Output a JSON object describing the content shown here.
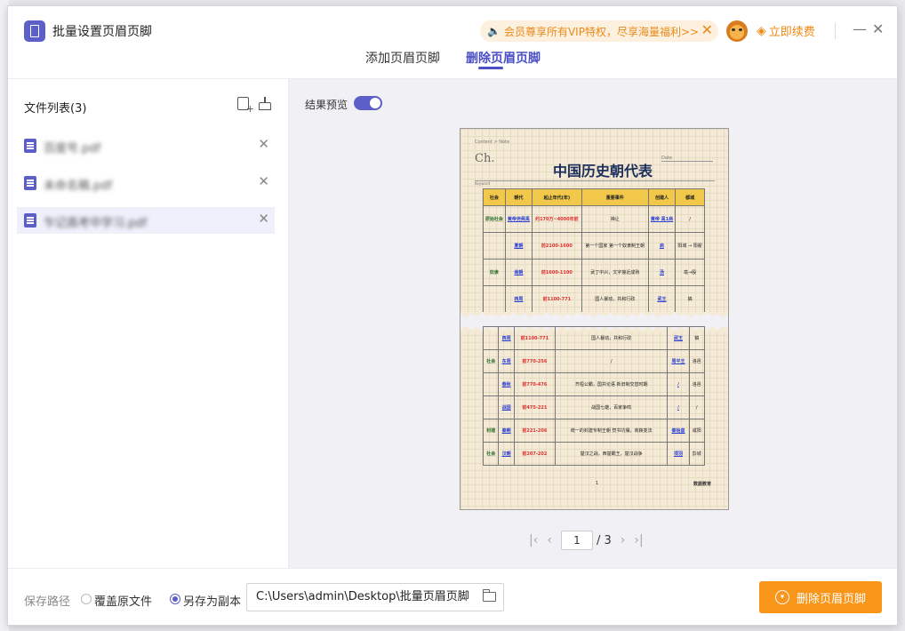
{
  "app": {
    "title": "批量设置页眉页脚"
  },
  "vip_banner": {
    "text": "会员尊享所有VIP特权，尽享海量福利>>",
    "close": "✕"
  },
  "renew": {
    "label": "立即续费"
  },
  "window": {
    "minimize": "—",
    "close": "✕"
  },
  "tabs": [
    {
      "label": "添加页眉页脚",
      "active": false
    },
    {
      "label": "删除页眉页脚",
      "active": true
    }
  ],
  "sidebar": {
    "title": "文件列表(3)",
    "files": [
      {
        "name": "百度号.pdf",
        "selected": false
      },
      {
        "name": "未命名稿.pdf",
        "selected": false
      },
      {
        "name": "乍记高考中学习.pdf",
        "selected": true
      }
    ]
  },
  "preview": {
    "label": "结果预览",
    "toggle_on": true,
    "doc": {
      "breadcrumb": "Content > Note",
      "ch": "Ch.",
      "date": "Date",
      "keyword": "Keyword",
      "title": "中国历史朝代表",
      "headers": [
        "社会",
        "朝代",
        "起止年代(年)",
        "重要事件",
        "创建人",
        "都城"
      ],
      "rows_top": [
        [
          "原始社会",
          "黄帝尧舜禹",
          "约170万~4000年前",
          "禅让",
          "黄帝 禹1商",
          "/"
        ],
        [
          "",
          "夏朝",
          "前2100-1600",
          "第一个国家 第一个奴隶制王朝",
          "启",
          "阳城 → 阳翟"
        ],
        [
          "奴隶",
          "商朝",
          "前1600-1100",
          "武丁中兴，文字接近成熟",
          "汤",
          "亳→殷"
        ],
        [
          "",
          "西周",
          "前1100-771",
          "国人暴动，共和行政",
          "武王",
          "镐"
        ]
      ],
      "rows_bottom": [
        [
          "",
          "西周",
          "前1100-771",
          "国人暴动，共和行政",
          "武王",
          "镐"
        ],
        [
          "社会",
          "东周",
          "前770-256",
          "/",
          "周平王",
          "洛邑"
        ],
        [
          "",
          "春秋",
          "前770-476",
          "齐桓公霸，国共论语 新旧制交替时期",
          "/",
          "洛邑"
        ],
        [
          "",
          "战国",
          "前475-221",
          "战国七雄，百家争鸣",
          "/",
          "/"
        ],
        [
          "封建",
          "秦朝",
          "前221-206",
          "统一的封建专制王朝 焚书坑儒，商鞅变法",
          "秦始皇",
          "咸阳"
        ],
        [
          "社会",
          "汉朝",
          "前207-202",
          "楚汉之战，西楚霸王，楚汉战争",
          "项羽",
          "彭城"
        ]
      ],
      "page_no": "1",
      "brand": "数据教育"
    },
    "pager": {
      "current": "1",
      "total": "/ 3"
    }
  },
  "footer": {
    "label": "保存路径",
    "options": [
      {
        "label": "覆盖原文件",
        "checked": false
      },
      {
        "label": "另存为副本",
        "checked": true
      }
    ],
    "path": "C:\\Users\\admin\\Desktop\\批量页眉页脚",
    "action": "删除页眉页脚"
  },
  "colors": {
    "accent": "#5b5fc7",
    "action": "#f9961a",
    "vip": "#e88a1a"
  }
}
